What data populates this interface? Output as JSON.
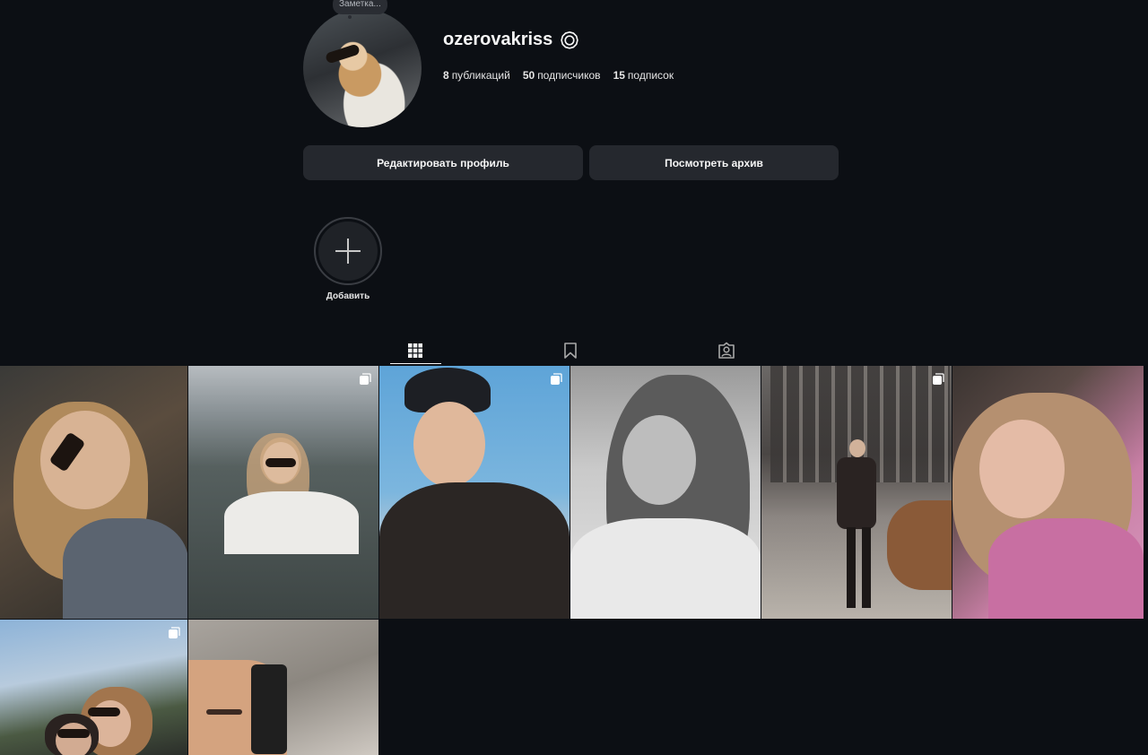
{
  "profile": {
    "note": "Заметка...",
    "username": "ozerovakriss",
    "stats": {
      "posts_count": "8",
      "posts_label": "публикаций",
      "followers_count": "50",
      "followers_label": "подписчиков",
      "following_count": "15",
      "following_label": "подписок"
    }
  },
  "actions": {
    "edit_label": "Редактировать профиль",
    "archive_label": "Посмотреть архив"
  },
  "highlights": {
    "add_label": "Добавить"
  },
  "tabs": [
    {
      "name": "posts",
      "icon": "grid-icon",
      "active": true
    },
    {
      "name": "saved",
      "icon": "bookmark-icon",
      "active": false
    },
    {
      "name": "tagged",
      "icon": "tagged-icon",
      "active": false
    }
  ],
  "grid": [
    {
      "multi": false
    },
    {
      "multi": true
    },
    {
      "multi": true
    },
    {
      "multi": false
    },
    {
      "multi": true
    },
    {
      "multi": false
    },
    {
      "multi": true
    },
    {
      "multi": false
    }
  ],
  "colors": {
    "background": "#0c0f14",
    "button": "#25282e",
    "text": "#f5f5f5"
  }
}
